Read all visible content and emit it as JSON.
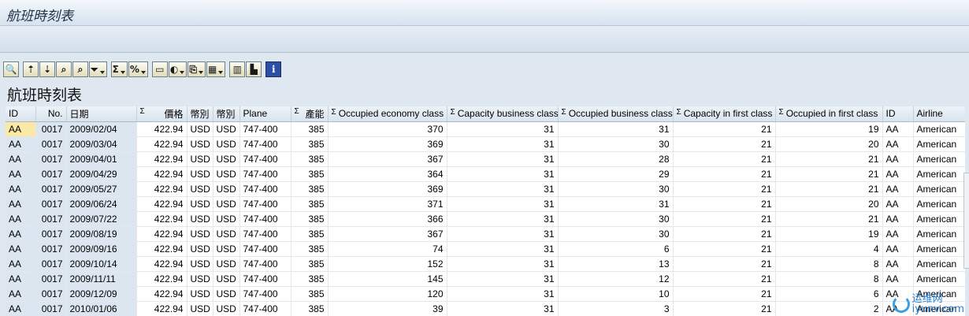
{
  "window": {
    "title": "航班時刻表"
  },
  "toolbar": {
    "buttons": [
      {
        "name": "details-button",
        "icon": "magnifier-icon",
        "glyph": "🔍",
        "drop": false
      },
      {
        "name": "sep1",
        "sep": true
      },
      {
        "name": "sort-ascending-button",
        "icon": "sort-up-icon",
        "glyph": "⇡",
        "drop": false
      },
      {
        "name": "sort-descending-button",
        "icon": "sort-down-icon",
        "glyph": "⇣",
        "drop": false
      },
      {
        "name": "find-button",
        "icon": "binoculars-icon",
        "glyph": "⌕",
        "drop": false
      },
      {
        "name": "find-next-button",
        "icon": "binoculars-next-icon",
        "glyph": "⌕",
        "drop": false
      },
      {
        "name": "filter-button",
        "icon": "funnel-icon",
        "glyph": "⏷",
        "drop": true
      },
      {
        "name": "sep2",
        "sep": true
      },
      {
        "name": "total-button",
        "icon": "sigma-icon",
        "glyph": "Σ",
        "drop": true
      },
      {
        "name": "subtotal-button",
        "icon": "subtotal-icon",
        "glyph": "%",
        "drop": true
      },
      {
        "name": "sep3",
        "sep": true
      },
      {
        "name": "print-preview-button",
        "icon": "page-icon",
        "glyph": "▭",
        "drop": false
      },
      {
        "name": "views-button",
        "icon": "views-icon",
        "glyph": "◐",
        "drop": true
      },
      {
        "name": "export-button",
        "icon": "export-icon",
        "glyph": "⎘",
        "drop": true
      },
      {
        "name": "layout-button",
        "icon": "grid-icon",
        "glyph": "▦",
        "drop": true
      },
      {
        "name": "sep4",
        "sep": true
      },
      {
        "name": "change-layout-button",
        "icon": "columns-icon",
        "glyph": "▥",
        "drop": false
      },
      {
        "name": "graphic-button",
        "icon": "chart-icon",
        "glyph": "▙",
        "drop": false
      },
      {
        "name": "sep5",
        "sep": true
      },
      {
        "name": "info-button",
        "icon": "info-icon",
        "glyph": "i",
        "drop": false,
        "info": true
      }
    ]
  },
  "list": {
    "title": "航班時刻表",
    "columns": [
      {
        "label": "ID",
        "width": 38,
        "sigma": false,
        "align": "left"
      },
      {
        "label": "No.",
        "width": 39,
        "sigma": false,
        "align": "right"
      },
      {
        "label": "日期",
        "width": 89,
        "sigma": false,
        "align": "left"
      },
      {
        "label": "價格",
        "width": 64,
        "sigma": true,
        "align": "right"
      },
      {
        "label": "幣別",
        "width": 33,
        "sigma": false,
        "align": "left"
      },
      {
        "label": "幣別",
        "width": 34,
        "sigma": false,
        "align": "left"
      },
      {
        "label": "Plane",
        "width": 65,
        "sigma": false,
        "align": "left"
      },
      {
        "label": "產能",
        "width": 47,
        "sigma": true,
        "align": "right"
      },
      {
        "label": "Occupied economy class",
        "width": 151,
        "sigma": true,
        "align": "left"
      },
      {
        "label": "Capacity business class",
        "width": 141,
        "sigma": true,
        "align": "left"
      },
      {
        "label": "Occupied business class",
        "width": 146,
        "sigma": true,
        "align": "left"
      },
      {
        "label": "Capacity in first class",
        "width": 130,
        "sigma": true,
        "align": "left"
      },
      {
        "label": "Occupied in first class",
        "width": 136,
        "sigma": true,
        "align": "left"
      },
      {
        "label": "ID",
        "width": 39,
        "sigma": false,
        "align": "left"
      },
      {
        "label": "Airline",
        "width": 66,
        "sigma": false,
        "align": "left"
      }
    ],
    "rows": [
      [
        "AA",
        "0017",
        "2009/02/04",
        "422.94",
        "USD",
        "USD",
        "747-400",
        "385",
        "370",
        "31",
        "31",
        "21",
        "19",
        "AA",
        "American"
      ],
      [
        "AA",
        "0017",
        "2009/03/04",
        "422.94",
        "USD",
        "USD",
        "747-400",
        "385",
        "369",
        "31",
        "30",
        "21",
        "20",
        "AA",
        "American"
      ],
      [
        "AA",
        "0017",
        "2009/04/01",
        "422.94",
        "USD",
        "USD",
        "747-400",
        "385",
        "367",
        "31",
        "28",
        "21",
        "21",
        "AA",
        "American"
      ],
      [
        "AA",
        "0017",
        "2009/04/29",
        "422.94",
        "USD",
        "USD",
        "747-400",
        "385",
        "364",
        "31",
        "29",
        "21",
        "21",
        "AA",
        "American"
      ],
      [
        "AA",
        "0017",
        "2009/05/27",
        "422.94",
        "USD",
        "USD",
        "747-400",
        "385",
        "369",
        "31",
        "30",
        "21",
        "21",
        "AA",
        "American"
      ],
      [
        "AA",
        "0017",
        "2009/06/24",
        "422.94",
        "USD",
        "USD",
        "747-400",
        "385",
        "371",
        "31",
        "31",
        "21",
        "20",
        "AA",
        "American"
      ],
      [
        "AA",
        "0017",
        "2009/07/22",
        "422.94",
        "USD",
        "USD",
        "747-400",
        "385",
        "366",
        "31",
        "30",
        "21",
        "21",
        "AA",
        "American"
      ],
      [
        "AA",
        "0017",
        "2009/08/19",
        "422.94",
        "USD",
        "USD",
        "747-400",
        "385",
        "367",
        "31",
        "30",
        "21",
        "19",
        "AA",
        "American"
      ],
      [
        "AA",
        "0017",
        "2009/09/16",
        "422.94",
        "USD",
        "USD",
        "747-400",
        "385",
        "74",
        "31",
        "6",
        "21",
        "4",
        "AA",
        "American"
      ],
      [
        "AA",
        "0017",
        "2009/10/14",
        "422.94",
        "USD",
        "USD",
        "747-400",
        "385",
        "152",
        "31",
        "13",
        "21",
        "8",
        "AA",
        "American"
      ],
      [
        "AA",
        "0017",
        "2009/11/11",
        "422.94",
        "USD",
        "USD",
        "747-400",
        "385",
        "145",
        "31",
        "12",
        "21",
        "8",
        "AA",
        "American"
      ],
      [
        "AA",
        "0017",
        "2009/12/09",
        "422.94",
        "USD",
        "USD",
        "747-400",
        "385",
        "120",
        "31",
        "10",
        "21",
        "6",
        "AA",
        "American"
      ],
      [
        "AA",
        "0017",
        "2010/01/06",
        "422.94",
        "USD",
        "USD",
        "747-400",
        "385",
        "39",
        "31",
        "3",
        "21",
        "2",
        "AA",
        "American"
      ]
    ]
  },
  "watermark": {
    "line1": "运维网",
    "line2": "iyunv.com"
  },
  "colors": {
    "selected_cell": "#fbe8a5",
    "header_bg": "#d9e4ee",
    "workarea_bg": "#dfe8f1"
  }
}
